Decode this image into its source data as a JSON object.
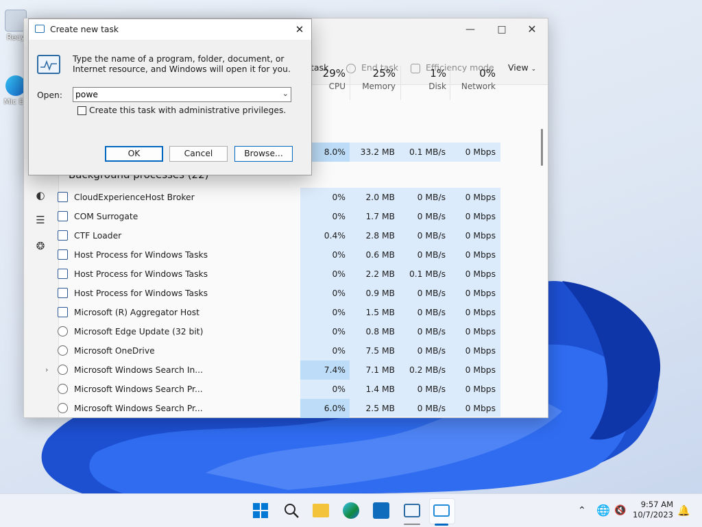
{
  "desktop": {
    "icons": [
      {
        "label": "Recy"
      },
      {
        "label": "Mic Ec"
      }
    ]
  },
  "task_manager": {
    "toolbar": {
      "run_task_label": "task",
      "end_task_label": "End task",
      "efficiency_label": "Efficiency mode",
      "view_label": "View"
    },
    "columns": [
      {
        "pct": "29%",
        "label": "CPU"
      },
      {
        "pct": "25%",
        "label": "Memory"
      },
      {
        "pct": "1%",
        "label": "Disk"
      },
      {
        "pct": "0%",
        "label": "Network"
      }
    ],
    "top_row": {
      "cpu": "8.0%",
      "memory": "33.2 MB",
      "disk": "0.1 MB/s",
      "network": "0 Mbps"
    },
    "section_title": "Background processes (22)",
    "processes": [
      {
        "name": "CloudExperienceHost Broker",
        "cpu": "0%",
        "memory": "2.0 MB",
        "disk": "0 MB/s",
        "network": "0 Mbps"
      },
      {
        "name": "COM Surrogate",
        "cpu": "0%",
        "memory": "1.7 MB",
        "disk": "0 MB/s",
        "network": "0 Mbps"
      },
      {
        "name": "CTF Loader",
        "cpu": "0.4%",
        "memory": "2.8 MB",
        "disk": "0 MB/s",
        "network": "0 Mbps"
      },
      {
        "name": "Host Process for Windows Tasks",
        "cpu": "0%",
        "memory": "0.6 MB",
        "disk": "0 MB/s",
        "network": "0 Mbps"
      },
      {
        "name": "Host Process for Windows Tasks",
        "cpu": "0%",
        "memory": "2.2 MB",
        "disk": "0.1 MB/s",
        "network": "0 Mbps"
      },
      {
        "name": "Host Process for Windows Tasks",
        "cpu": "0%",
        "memory": "0.9 MB",
        "disk": "0 MB/s",
        "network": "0 Mbps"
      },
      {
        "name": "Microsoft (R) Aggregator Host",
        "cpu": "0%",
        "memory": "1.5 MB",
        "disk": "0 MB/s",
        "network": "0 Mbps"
      },
      {
        "name": "Microsoft Edge Update (32 bit)",
        "cpu": "0%",
        "memory": "0.8 MB",
        "disk": "0 MB/s",
        "network": "0 Mbps"
      },
      {
        "name": "Microsoft OneDrive",
        "cpu": "0%",
        "memory": "7.5 MB",
        "disk": "0 MB/s",
        "network": "0 Mbps"
      },
      {
        "name": "Microsoft Windows Search In...",
        "cpu": "7.4%",
        "memory": "7.1 MB",
        "disk": "0.2 MB/s",
        "network": "0 Mbps"
      },
      {
        "name": "Microsoft Windows Search Pr...",
        "cpu": "0%",
        "memory": "1.4 MB",
        "disk": "0 MB/s",
        "network": "0 Mbps"
      },
      {
        "name": "Microsoft Windows Search Pr...",
        "cpu": "6.0%",
        "memory": "2.5 MB",
        "disk": "0 MB/s",
        "network": "0 Mbps"
      }
    ]
  },
  "dialog": {
    "title": "Create new task",
    "description": "Type the name of a program, folder, document, or Internet resource, and Windows will open it for you.",
    "open_label": "Open:",
    "open_value": "powe",
    "admin_checkbox_label": "Create this task with administrative privileges.",
    "ok_label": "OK",
    "cancel_label": "Cancel",
    "browse_label": "Browse..."
  },
  "taskbar": {
    "time": "9:57 AM",
    "date": "10/7/2023"
  },
  "colors": {
    "heat_light": "#dcebfb",
    "heat_medium": "#bcdcf7",
    "accent": "#0067c0"
  }
}
